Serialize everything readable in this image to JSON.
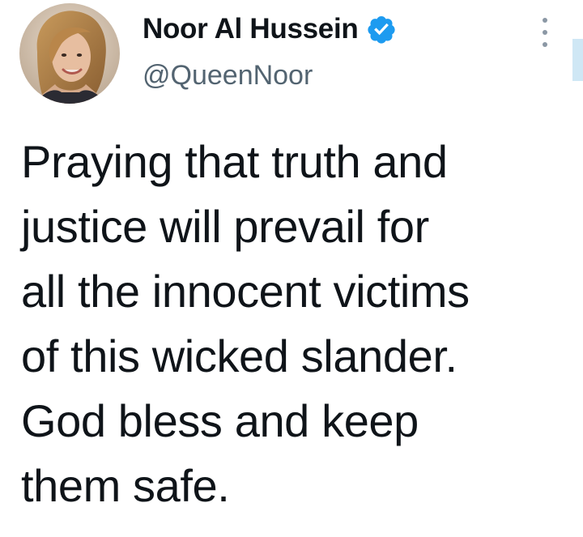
{
  "author": {
    "display_name": "Noor Al Hussein",
    "handle": "@QueenNoor",
    "verified": true,
    "verified_color": "#1d9bf0",
    "avatar_icon": "profile-photo"
  },
  "tweet": {
    "lines": [
      "Praying that truth and",
      "justice will prevail for",
      "all the innocent victims",
      "of this wicked slander.",
      "God bless and keep",
      "them safe."
    ]
  },
  "menu": {
    "icon": "more-vertical-icon"
  }
}
